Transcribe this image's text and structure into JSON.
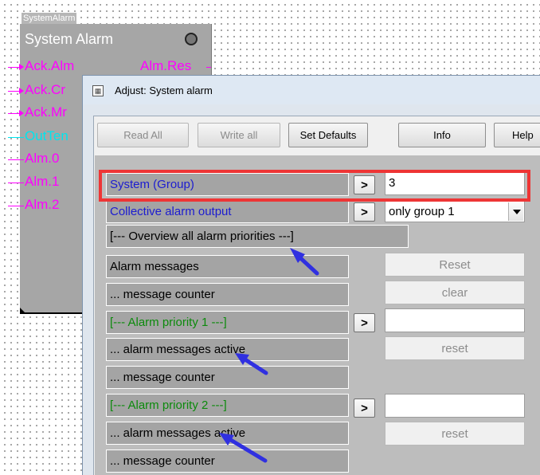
{
  "function_block": {
    "tag": "SystemAlarm",
    "title": "System Alarm",
    "inputs": [
      "Ack.Alm",
      "Ack.Cr",
      "Ack.Mr",
      "OutTen",
      "Alm.0",
      "Alm.1",
      "Alm.2"
    ],
    "outputs": [
      "Alm.Res"
    ]
  },
  "dialog": {
    "title": "Adjust: System alarm",
    "toolbar": {
      "read_all": "Read All",
      "write_all": "Write all",
      "set_defaults": "Set Defaults",
      "info": "Info",
      "help": "Help"
    },
    "rows": [
      {
        "label": "System (Group)",
        "arrow": ">",
        "value": "3"
      },
      {
        "label": "Collective alarm output",
        "arrow": ">",
        "value": "only group 1"
      },
      {
        "label": "[--- Overview all alarm priorities ---]"
      },
      {
        "label": "Alarm messages",
        "button": "Reset"
      },
      {
        "label": "... message counter",
        "button": "clear"
      },
      {
        "label": "[--- Alarm priority 1 ---]",
        "arrow": ">",
        "value": ""
      },
      {
        "label": "... alarm messages active",
        "button": "reset"
      },
      {
        "label": "... message counter"
      },
      {
        "label": "[--- Alarm priority 2 ---]",
        "arrow": ">",
        "value": ""
      },
      {
        "label": "... alarm messages active",
        "button": "reset"
      },
      {
        "label": "... message counter"
      }
    ]
  },
  "colors": {
    "highlight": "#ee3535",
    "annotation_arrow": "#3030e0",
    "pin_magenta": "#ff00ff",
    "pin_cyan": "#00e5ee"
  }
}
